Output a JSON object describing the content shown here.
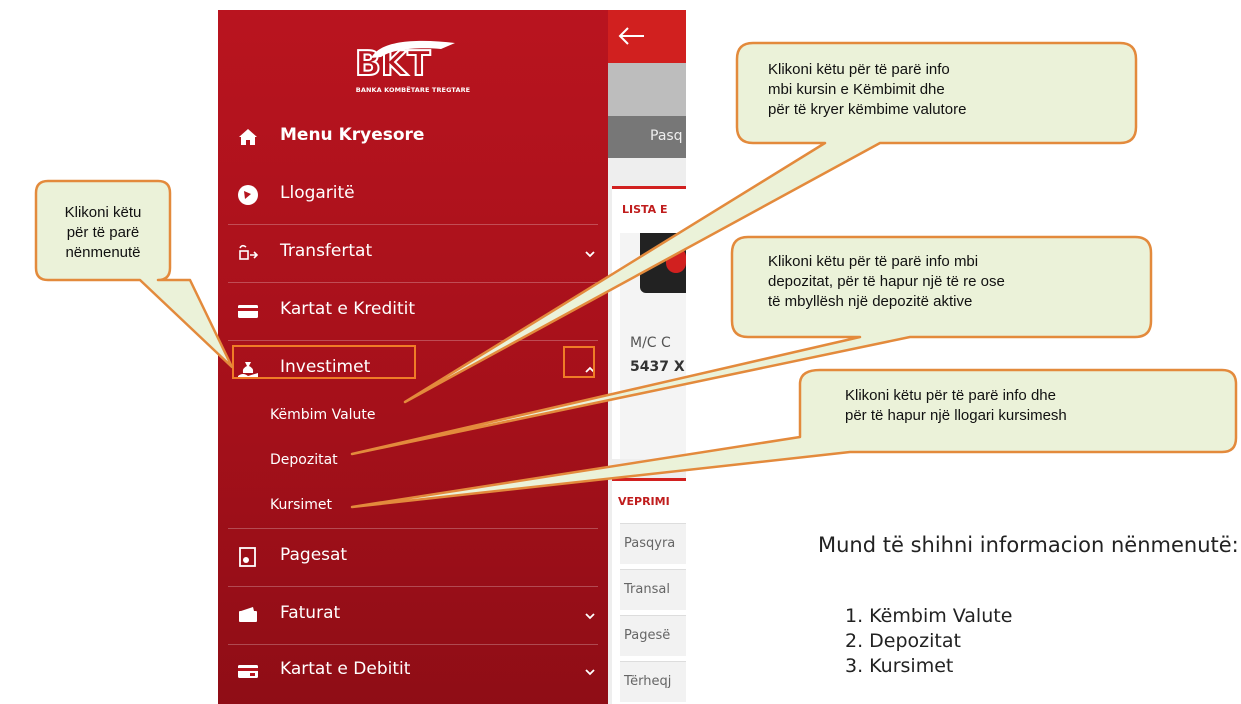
{
  "sidebar": {
    "logo_text": "BKT",
    "logo_subtitle": "BANKA KOMBËTARE TREGTARE",
    "items": [
      {
        "label": "Menu Kryesore",
        "icon": "home-icon"
      },
      {
        "label": "Llogaritë",
        "icon": "account-icon"
      },
      {
        "label": "Transfertat",
        "icon": "transfer-icon"
      },
      {
        "label": "Kartat e Kreditit",
        "icon": "credit-card-icon"
      },
      {
        "label": "Investimet",
        "icon": "money-bag-icon"
      },
      {
        "label": "Pagesat",
        "icon": "payment-icon"
      },
      {
        "label": "Faturat",
        "icon": "wallet-icon"
      },
      {
        "label": "Kartat e Debitit",
        "icon": "debit-card-icon"
      }
    ],
    "subitems": [
      "Këmbim Valute",
      "Depozitat",
      "Kursimet"
    ]
  },
  "app_background": {
    "tab": "Pasq",
    "card1_title": "LISTA E",
    "card_label": "M/C C",
    "card_number": "5437 X",
    "card2_title": "VEPRIMI",
    "rows": [
      "Pasqyra",
      "Transal",
      "Pagesë",
      "Tërheqj"
    ]
  },
  "callouts": {
    "submenus": [
      "Klikoni këtu",
      "për të parë",
      "nënmenutë"
    ],
    "exchange": [
      "Klikoni këtu për të parë info",
      "mbi kursin e Këmbimit dhe",
      "për të kryer këmbime valutore"
    ],
    "deposits": [
      "Klikoni këtu për të parë info mbi",
      "depozitat, për të hapur një të re ose",
      "të mbyllësh një depozitë aktive"
    ],
    "savings": [
      "Klikoni këtu për të parë info dhe",
      "për të hapur një llogari kursimesh"
    ]
  },
  "note": {
    "text": "Mund të shihni informacion nënmenutë:",
    "items": [
      "1.  Këmbim Valute",
      "2.  Depozitat",
      "3.  Kursimet"
    ]
  },
  "colors": {
    "sidebar": "#b5141e",
    "highlight": "#f07c27",
    "callout_fill": "#ebf2d9",
    "callout_border": "#e38a3c"
  }
}
